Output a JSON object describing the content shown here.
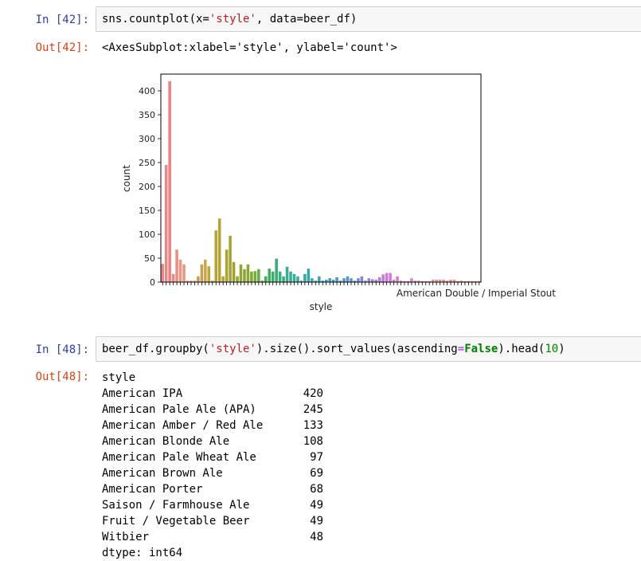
{
  "cells": [
    {
      "in_prompt": "In [42]:",
      "code": {
        "pre": "sns.countplot(x=",
        "arg": "'style'",
        "post": ", data=beer_df)"
      },
      "out_prompt": "Out[42]:",
      "out_text": "<AxesSubplot:xlabel='style', ylabel='count'>"
    },
    {
      "in_prompt": "In [48]:",
      "code": {
        "pre": "beer_df.groupby(",
        "arg": "'style'",
        "mid": ").size().sort_values(ascending",
        "eq": "=",
        "kw": "False",
        "mid2": ").head(",
        "num": "10",
        "post": ")"
      },
      "out_prompt": "Out[48]:",
      "series": {
        "header": "style",
        "rows": [
          {
            "name": "American IPA",
            "value": "420"
          },
          {
            "name": "American Pale Ale (APA)",
            "value": "245"
          },
          {
            "name": "American Amber / Red Ale",
            "value": "133"
          },
          {
            "name": "American Blonde Ale",
            "value": "108"
          },
          {
            "name": "American Pale Wheat Ale",
            "value": "97"
          },
          {
            "name": "American Brown Ale",
            "value": "69"
          },
          {
            "name": "American Porter",
            "value": "68"
          },
          {
            "name": "Saison / Farmhouse Ale",
            "value": "49"
          },
          {
            "name": "Fruit / Vegetable Beer",
            "value": "49"
          },
          {
            "name": "Witbier",
            "value": "48"
          }
        ],
        "dtype": "dtype: int64"
      }
    }
  ],
  "chart_data": {
    "type": "bar",
    "xlabel": "style",
    "ylabel": "count",
    "ylim": [
      0,
      435
    ],
    "yticks": [
      0,
      50,
      100,
      150,
      200,
      250,
      300,
      350,
      400
    ],
    "visible_tick_label_tail": "American Double / Imperial Stout",
    "values": [
      38,
      245,
      420,
      17,
      68,
      47,
      37,
      3,
      3,
      3,
      12,
      37,
      47,
      33,
      3,
      108,
      133,
      12,
      68,
      97,
      42,
      12,
      37,
      27,
      37,
      22,
      23,
      27,
      3,
      12,
      28,
      22,
      49,
      22,
      12,
      32,
      22,
      17,
      12,
      3,
      17,
      28,
      8,
      3,
      12,
      3,
      5,
      8,
      5,
      10,
      3,
      8,
      12,
      8,
      3,
      8,
      12,
      3,
      8,
      6,
      5,
      10,
      16,
      19,
      19,
      5,
      12,
      3,
      2,
      2,
      8,
      3,
      3,
      2,
      2,
      2,
      5,
      5,
      5,
      5,
      3,
      5,
      5,
      2,
      3,
      2,
      2,
      2,
      2,
      2
    ],
    "colors": [
      "#e58a84",
      "#e58a84",
      "#f08080",
      "#e98a84",
      "#e99080",
      "#e8958a",
      "#e89680",
      "#e2a07c",
      "#dc9e78",
      "#d6a072",
      "#c99a5a",
      "#c9a050",
      "#c7a84a",
      "#c0a43c",
      "#bfa23a",
      "#b8a333",
      "#b7a233",
      "#b2a532",
      "#a9a332",
      "#a2a533",
      "#9ca332",
      "#98a334",
      "#94a534",
      "#8ea533",
      "#8aa634",
      "#7ca938",
      "#73ad3c",
      "#6aab3f",
      "#5fac46",
      "#49ad51",
      "#42ae60",
      "#3fad6a",
      "#3aad76",
      "#3aaf80",
      "#39ad87",
      "#38ad8d",
      "#37ad92",
      "#37ac98",
      "#38ab9d",
      "#38aaa0",
      "#39aaa5",
      "#3aa8aa",
      "#3ba7ad",
      "#3ca5b1",
      "#3da4b5",
      "#3ea3b8",
      "#40a1bc",
      "#429fbf",
      "#449dc2",
      "#479bc6",
      "#4a99ca",
      "#4e96ce",
      "#5594d2",
      "#5d91d6",
      "#678fd9",
      "#728bdc",
      "#7e88de",
      "#8b85e0",
      "#9882e1",
      "#a57fe2",
      "#b07de1",
      "#b97be0",
      "#c27add",
      "#c97ada",
      "#d07ad6",
      "#d57bd2",
      "#da7cce",
      "#de7dca",
      "#e17ec5",
      "#e47fc0",
      "#e680bb",
      "#e881b6",
      "#ea82b1",
      "#eb83ac",
      "#ec84a8",
      "#ed84a3",
      "#ed859e",
      "#ee869a",
      "#ee8796",
      "#ee8892",
      "#ee888e",
      "#ee898b",
      "#ee8a88",
      "#ee8a86",
      "#ee8b84",
      "#ee8b83",
      "#ee8c82",
      "#ee8c81",
      "#ee8c80",
      "#ee8d80"
    ]
  }
}
